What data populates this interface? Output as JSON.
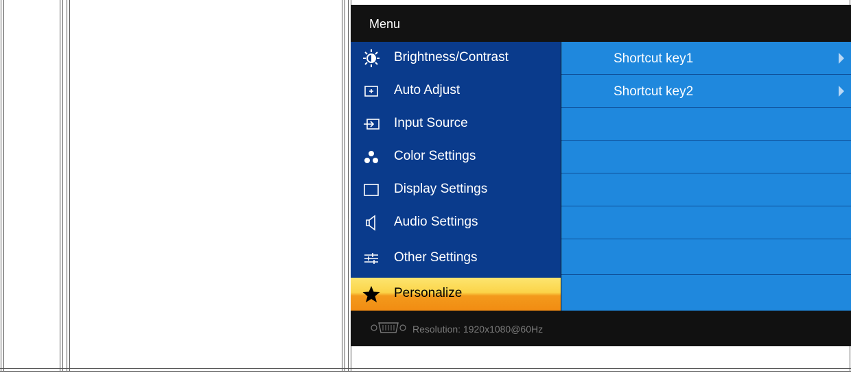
{
  "osd": {
    "title": "Menu",
    "menu_items": [
      {
        "label": "Brightness/Contrast",
        "icon": "brightness-icon"
      },
      {
        "label": "Auto Adjust",
        "icon": "auto-adjust-icon"
      },
      {
        "label": "Input Source",
        "icon": "input-source-icon"
      },
      {
        "label": "Color Settings",
        "icon": "color-settings-icon"
      },
      {
        "label": "Display Settings",
        "icon": "display-settings-icon"
      },
      {
        "label": "Audio Settings",
        "icon": "speaker-icon"
      },
      {
        "label": "Other Settings",
        "icon": "sliders-icon"
      },
      {
        "label": "Personalize",
        "icon": "star-icon",
        "selected": true
      }
    ],
    "submenu": [
      {
        "label": "Shortcut key1",
        "icon": "arrow-right-icon"
      },
      {
        "label": "Shortcut key2",
        "icon": "arrow-right-icon"
      }
    ],
    "status": {
      "connector_icon": "vga-connector-icon",
      "resolution": "Resolution:  1920x1080@60Hz"
    }
  },
  "colors": {
    "menu_bg": "#0a3b8c",
    "submenu_bg": "#1f88dd",
    "selected_top": "#fde56f",
    "selected_bottom": "#f28c12",
    "osd_bg": "#111111"
  }
}
